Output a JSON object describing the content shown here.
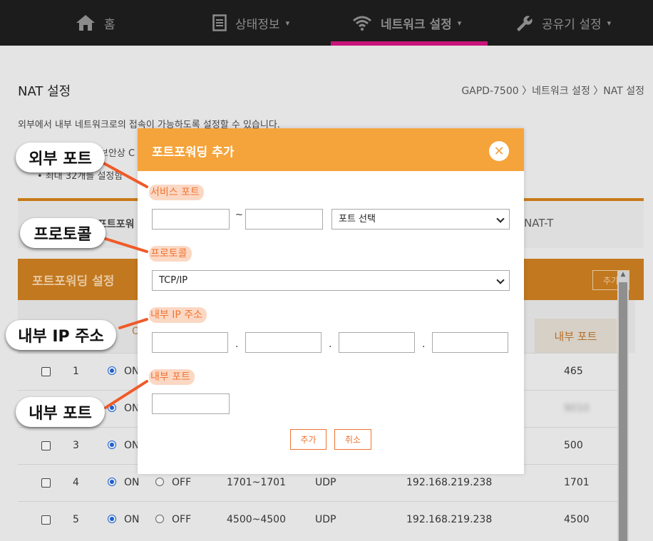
{
  "nav": {
    "home": "홈",
    "status": "상태정보",
    "network": "네트워크 설정",
    "router": "공유기 설정",
    "caret": "▾"
  },
  "page": {
    "title": "NAT 설정",
    "breadcrumb": "GAPD-7500 〉네트워크 설정 〉NAT 설정",
    "desc1": "외부에서 내부 네트워크로의 접속이 가능하도록 설정할 수 있습니다.",
    "desc2": "보안상 C",
    "desc3": "• 최대 32개를 설정함",
    "band_left": "포트포워",
    "band_right": "NAT-T",
    "table_title": "포트포워딩 설정",
    "add_label": "추가",
    "col_on": "O",
    "col_internal_port": "내부 포트"
  },
  "rows": [
    {
      "num": "1",
      "on": "ON",
      "off": "",
      "ext": "",
      "proto": "",
      "ip": "",
      "port": "465"
    },
    {
      "num": "2",
      "on": "ON",
      "off": "",
      "ext": "",
      "proto": "",
      "ip": "",
      "port": "9010"
    },
    {
      "num": "3",
      "on": "ON",
      "off": "",
      "ext": "",
      "proto": "",
      "ip": "",
      "port": "500"
    },
    {
      "num": "4",
      "on": "ON",
      "off": "OFF",
      "ext": "1701~1701",
      "proto": "UDP",
      "ip": "192.168.219.238",
      "port": "1701"
    },
    {
      "num": "5",
      "on": "ON",
      "off": "OFF",
      "ext": "4500~4500",
      "proto": "UDP",
      "ip": "192.168.219.238",
      "port": "4500"
    }
  ],
  "modal": {
    "title": "포트포워딩 추가",
    "close": "✕",
    "service_port_label": "서비스 포트",
    "dash": "~",
    "port_select": "포트 선택",
    "protocol_label": "프로토콜",
    "protocol_value": "TCP/IP",
    "ip_label": "내부 IP 주소",
    "dot": ".",
    "internal_port_label": "내부 포트",
    "add_button": "추가",
    "cancel_button": "취소"
  },
  "callouts": {
    "external_port": "외부 포트",
    "protocol": "프로토콜",
    "internal_ip": "내부 IP 주소",
    "internal_port": "내부 포트"
  },
  "colors": {
    "accent": "#f5a33b",
    "label_text": "#f07432",
    "nav_active_underline": "#c8147a",
    "callout_line": "#f05a28"
  }
}
